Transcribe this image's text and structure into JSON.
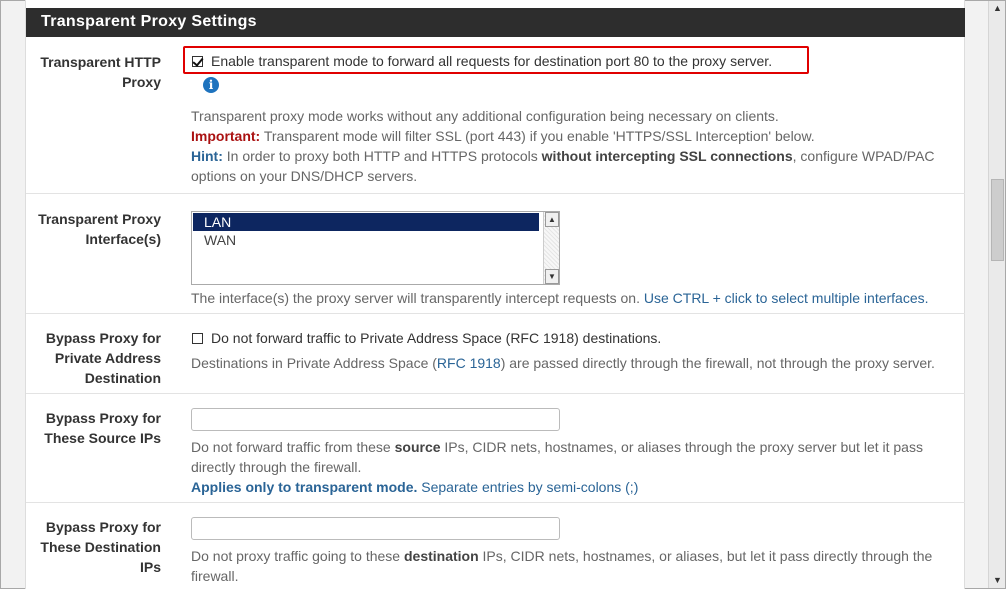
{
  "section": {
    "title": "Transparent Proxy Settings"
  },
  "transparent_http": {
    "label_line1": "Transparent HTTP",
    "label_line2": "Proxy",
    "checkbox_label": "Enable transparent mode to forward all requests for destination port 80 to the proxy server.",
    "checked": true,
    "info_icon": "i",
    "desc_line1": "Transparent proxy mode works without any additional configuration being necessary on clients.",
    "important_label": "Important:",
    "important_text": " Transparent mode will filter SSL (port 443) if you enable 'HTTPS/SSL Interception' below.",
    "hint_label": "Hint:",
    "hint_text_a": " In order to proxy both HTTP and HTTPS protocols ",
    "hint_bold": "without intercepting SSL connections",
    "hint_text_b": ", configure WPAD/PAC",
    "hint_line2": "options on your DNS/DHCP servers."
  },
  "interfaces": {
    "label_line1": "Transparent Proxy",
    "label_line2": "Interface(s)",
    "options": [
      "LAN",
      "WAN"
    ],
    "selected": "LAN",
    "desc": "The interface(s) the proxy server will transparently intercept requests on. ",
    "desc_link": "Use CTRL + click to select multiple interfaces."
  },
  "bypass_private": {
    "label_line1": "Bypass Proxy for",
    "label_line2": "Private Address",
    "label_line3": "Destination",
    "checkbox_label": "Do not forward traffic to Private Address Space (RFC 1918) destinations.",
    "checked": false,
    "desc_a": "Destinations in Private Address Space (",
    "desc_link": "RFC 1918",
    "desc_b": ") are passed directly through the firewall, not through the proxy server."
  },
  "bypass_source": {
    "label_line1": "Bypass Proxy for",
    "label_line2": "These Source IPs",
    "value": "",
    "desc_a": "Do not forward traffic from these ",
    "desc_bold": "source",
    "desc_b": " IPs, CIDR nets, hostnames, or aliases through the proxy server but let it pass",
    "desc_line2": "directly through the firewall.",
    "applies_bold": "Applies only to transparent mode.",
    "applies_rest": " Separate entries by semi-colons (;)"
  },
  "bypass_dest": {
    "label_line1": "Bypass Proxy for",
    "label_line2": "These Destination",
    "label_line3": "IPs",
    "value": "",
    "desc_a": "Do not proxy traffic going to these ",
    "desc_bold": "destination",
    "desc_b": " IPs, CIDR nets, hostnames, or aliases, but let it pass directly through the",
    "desc_line2": "firewall."
  }
}
